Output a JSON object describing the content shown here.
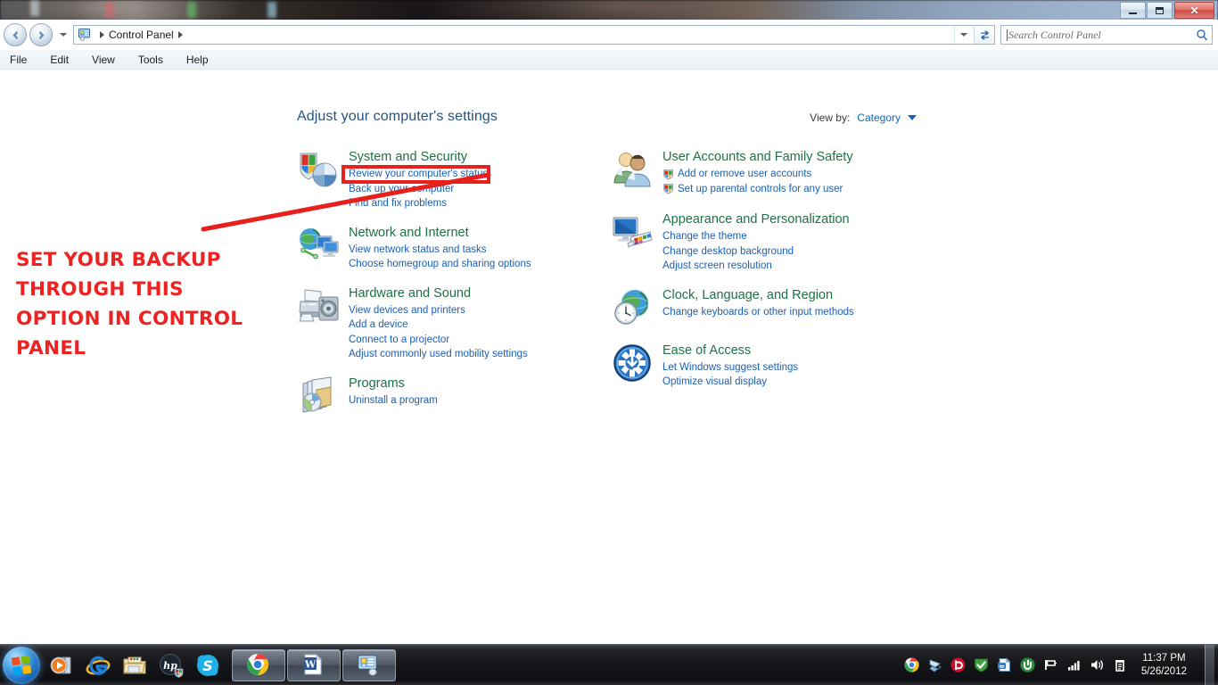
{
  "window": {
    "title": "Control Panel",
    "controls": {
      "minimize": "Minimize",
      "maximize": "Maximize",
      "close": "Close",
      "close_glyph": "✕"
    }
  },
  "address_bar": {
    "root_separator": "▸",
    "crumb": "Control Panel",
    "trailing_separator": "▸"
  },
  "search": {
    "placeholder": "Search Control Panel",
    "value": "",
    "icon": "search-icon"
  },
  "menubar": {
    "items": [
      {
        "label": "File"
      },
      {
        "label": "Edit"
      },
      {
        "label": "View"
      },
      {
        "label": "Tools"
      },
      {
        "label": "Help"
      }
    ]
  },
  "main": {
    "page_title": "Adjust your computer's settings",
    "view_by": {
      "label": "View by:",
      "value": "Category"
    }
  },
  "categories": {
    "left": [
      {
        "icon": "shield-and-pie-chart-icon",
        "title": "System and Security",
        "links": [
          {
            "label": "Review your computer's status",
            "shield": false
          },
          {
            "label": "Back up your computer",
            "shield": false,
            "highlighted": true
          },
          {
            "label": "Find and fix problems",
            "shield": false
          }
        ]
      },
      {
        "icon": "globe-and-monitors-icon",
        "title": "Network and Internet",
        "links": [
          {
            "label": "View network status and tasks",
            "shield": false
          },
          {
            "label": "Choose homegroup and sharing options",
            "shield": false
          }
        ]
      },
      {
        "icon": "printer-and-speaker-icon",
        "title": "Hardware and Sound",
        "links": [
          {
            "label": "View devices and printers",
            "shield": false
          },
          {
            "label": "Add a device",
            "shield": false
          },
          {
            "label": "Connect to a projector",
            "shield": false
          },
          {
            "label": "Adjust commonly used mobility settings",
            "shield": false
          }
        ]
      },
      {
        "icon": "programs-box-and-disc-icon",
        "title": "Programs",
        "links": [
          {
            "label": "Uninstall a program",
            "shield": false
          }
        ]
      }
    ],
    "right": [
      {
        "icon": "two-users-icon",
        "title": "User Accounts and Family Safety",
        "links": [
          {
            "label": "Add or remove user accounts",
            "shield": true
          },
          {
            "label": "Set up parental controls for any user",
            "shield": true
          }
        ]
      },
      {
        "icon": "monitor-and-color-palette-icon",
        "title": "Appearance and Personalization",
        "links": [
          {
            "label": "Change the theme",
            "shield": false
          },
          {
            "label": "Change desktop background",
            "shield": false
          },
          {
            "label": "Adjust screen resolution",
            "shield": false
          }
        ]
      },
      {
        "icon": "globe-and-clock-icon",
        "title": "Clock, Language, and Region",
        "links": [
          {
            "label": "Change keyboards or other input methods",
            "shield": false
          }
        ]
      },
      {
        "icon": "ease-of-access-wheel-icon",
        "title": "Ease of Access",
        "links": [
          {
            "label": "Let Windows suggest settings",
            "shield": false
          },
          {
            "label": "Optimize visual display",
            "shield": false
          }
        ]
      }
    ]
  },
  "annotation": {
    "text_lines": [
      "SET YOUR BACKUP",
      "THROUGH THIS",
      "OPTION IN CONTROL",
      "PANEL"
    ],
    "color": "#ef2222",
    "highlight_target": "Back up your computer"
  },
  "taskbar": {
    "start_button": "Start",
    "quick_launch": [
      {
        "name": "windows-media-player-icon",
        "label": "Windows Media Player"
      },
      {
        "name": "internet-explorer-icon",
        "label": "Internet Explorer"
      },
      {
        "name": "windows-explorer-icon",
        "label": "Windows Explorer"
      },
      {
        "name": "hp-support-icon",
        "label": "HP"
      },
      {
        "name": "skype-icon",
        "label": "Skype"
      }
    ],
    "running": [
      {
        "name": "chrome-icon",
        "label": "Google Chrome"
      },
      {
        "name": "word-icon",
        "label": "Microsoft Word"
      },
      {
        "name": "control-panel-icon",
        "label": "Control Panel"
      }
    ],
    "tray": [
      {
        "name": "chrome-tray-icon"
      },
      {
        "name": "dropbox-tray-icon"
      },
      {
        "name": "beats-audio-tray-icon"
      },
      {
        "name": "green-shield-tray-icon"
      },
      {
        "name": "blue-document-tray-icon"
      },
      {
        "name": "utorrent-tray-icon"
      },
      {
        "name": "safely-remove-hardware-icon"
      },
      {
        "name": "network-signal-icon"
      },
      {
        "name": "volume-icon"
      },
      {
        "name": "action-center-icon"
      }
    ],
    "clock": {
      "time": "11:37 PM",
      "date": "5/26/2012"
    }
  },
  "colors": {
    "category_title": "#1e7145",
    "link": "#1a5fb4",
    "page_title": "#26537e",
    "annotation_red": "#ef2222",
    "highlight_border": "#e8201b"
  }
}
